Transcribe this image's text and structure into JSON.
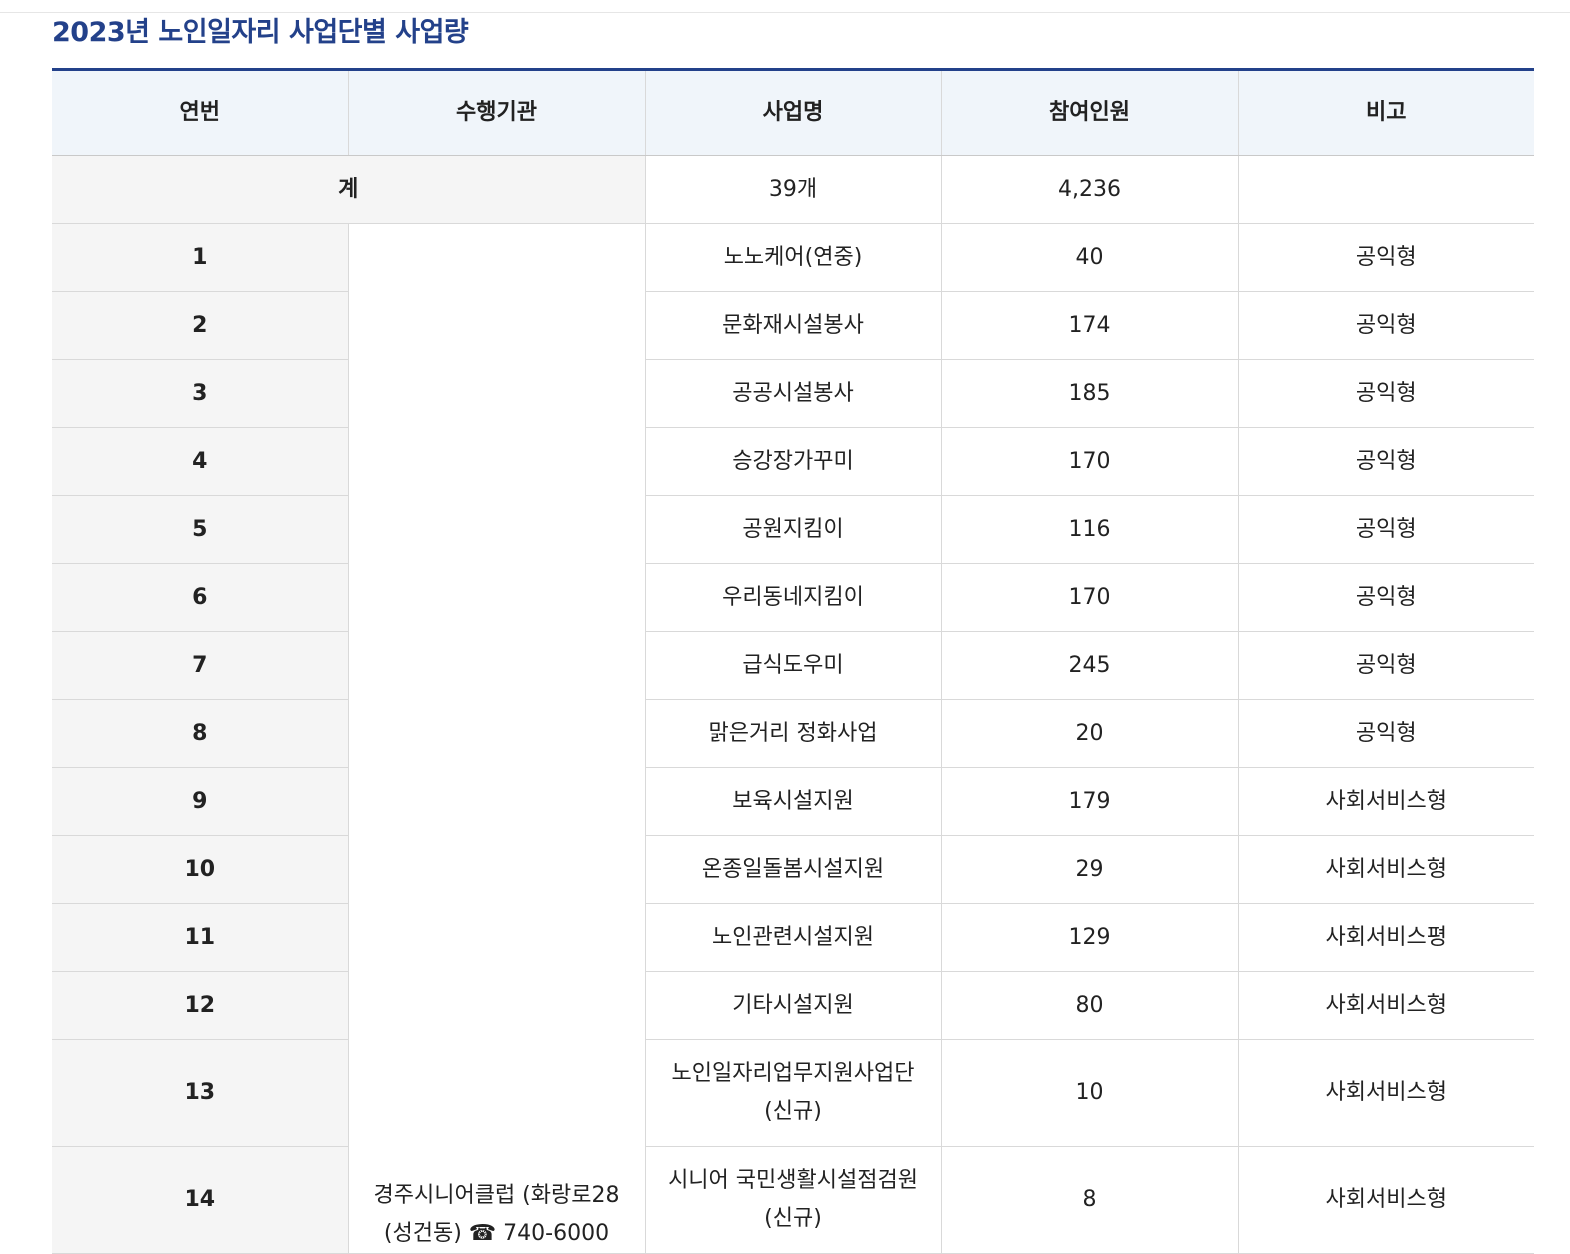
{
  "title": "2023년 노인일자리 사업단별 사업량",
  "headers": [
    "연번",
    "수행기관",
    "사업명",
    "참여인원",
    "비고"
  ],
  "total": {
    "label": "계",
    "project_count": "39개",
    "participants": "4,236",
    "note": ""
  },
  "organization": "경주시니어클럽 (화랑로28",
  "organization_contact": "(성건동)  ☎ 740-6000",
  "rows": [
    {
      "no": "1",
      "name": "노노케어(연중)",
      "count": "40",
      "note": "공익형"
    },
    {
      "no": "2",
      "name": "문화재시설봉사",
      "count": "174",
      "note": "공익형"
    },
    {
      "no": "3",
      "name": "공공시설봉사",
      "count": "185",
      "note": "공익형"
    },
    {
      "no": "4",
      "name": "승강장가꾸미",
      "count": "170",
      "note": "공익형"
    },
    {
      "no": "5",
      "name": "공원지킴이",
      "count": "116",
      "note": "공익형"
    },
    {
      "no": "6",
      "name": "우리동네지킴이",
      "count": "170",
      "note": "공익형"
    },
    {
      "no": "7",
      "name": "급식도우미",
      "count": "245",
      "note": "공익형"
    },
    {
      "no": "8",
      "name": "맑은거리 정화사업",
      "count": "20",
      "note": "공익형"
    },
    {
      "no": "9",
      "name": "보육시설지원",
      "count": "179",
      "note": "사회서비스형"
    },
    {
      "no": "10",
      "name": "온종일돌봄시설지원",
      "count": "29",
      "note": "사회서비스형"
    },
    {
      "no": "11",
      "name": "노인관련시설지원",
      "count": "129",
      "note": "사회서비스평"
    },
    {
      "no": "12",
      "name": "기타시설지원",
      "count": "80",
      "note": "사회서비스형"
    },
    {
      "no": "13",
      "name": "노인일자리업무지원사업단",
      "name2": "(신규)",
      "count": "10",
      "note": "사회서비스형"
    },
    {
      "no": "14",
      "name": "시니어 국민생활시설점검원",
      "name2": "(신규)",
      "count": "8",
      "note": "사회서비스형"
    }
  ]
}
